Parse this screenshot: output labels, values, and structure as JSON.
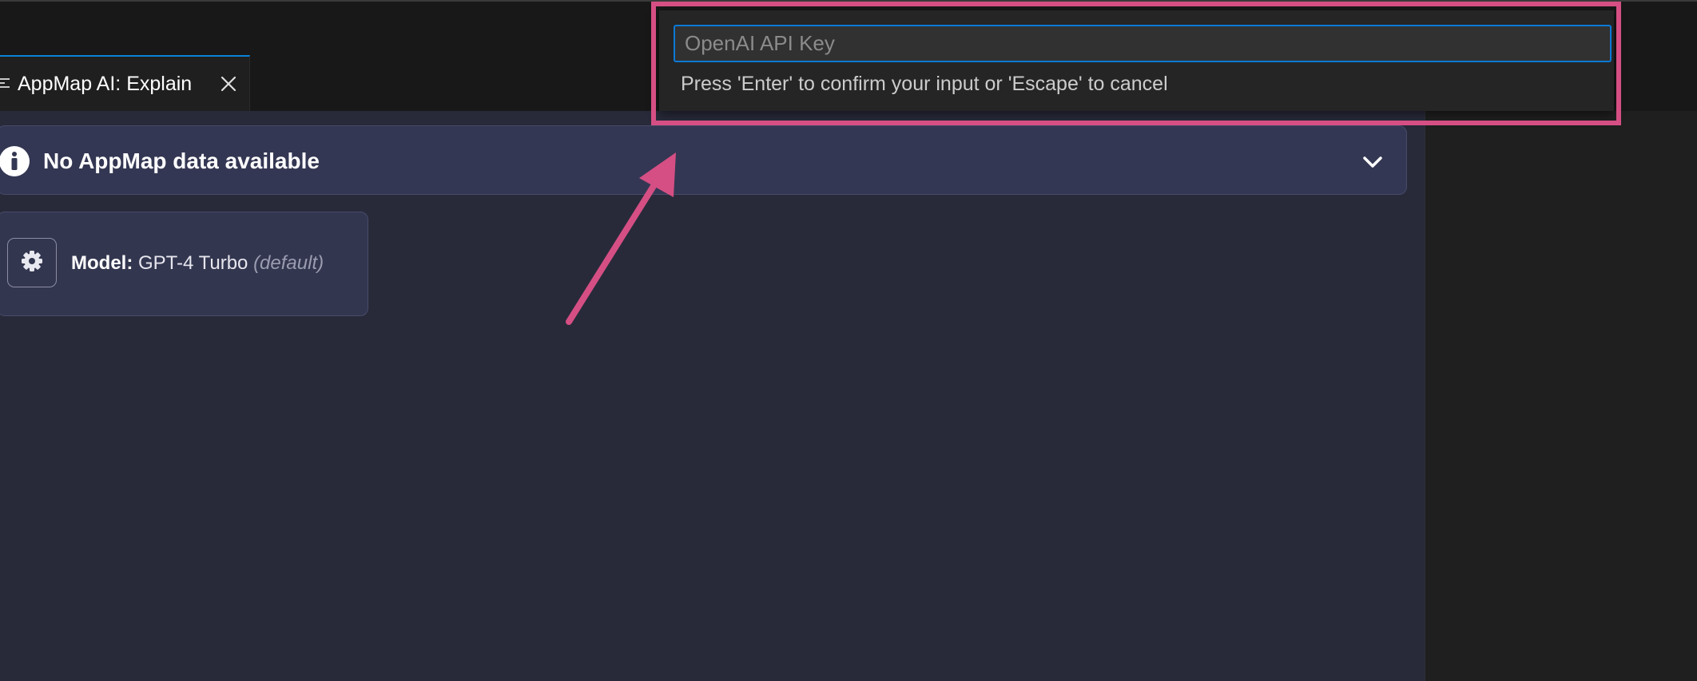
{
  "tab": {
    "label": "AppMap AI: Explain"
  },
  "banner": {
    "text": "No AppMap data available"
  },
  "model_card": {
    "label": "Model:",
    "value": "GPT-4 Turbo",
    "default_note": "(default)"
  },
  "quick_input": {
    "placeholder": "OpenAI API Key",
    "value": "",
    "message": "Press 'Enter' to confirm your input or 'Escape' to cancel"
  },
  "colors": {
    "highlight": "#d54f84",
    "focus_border": "#0b7ad6",
    "webview_background": "#282a3a",
    "banner_background": "#343753"
  },
  "icons": {
    "tab": "preview-lines-icon",
    "tab_close": "close-icon",
    "banner": "info-icon",
    "banner_toggle": "chevron-down-icon",
    "model_settings": "gear-icon",
    "annotation": "arrow-icon"
  }
}
